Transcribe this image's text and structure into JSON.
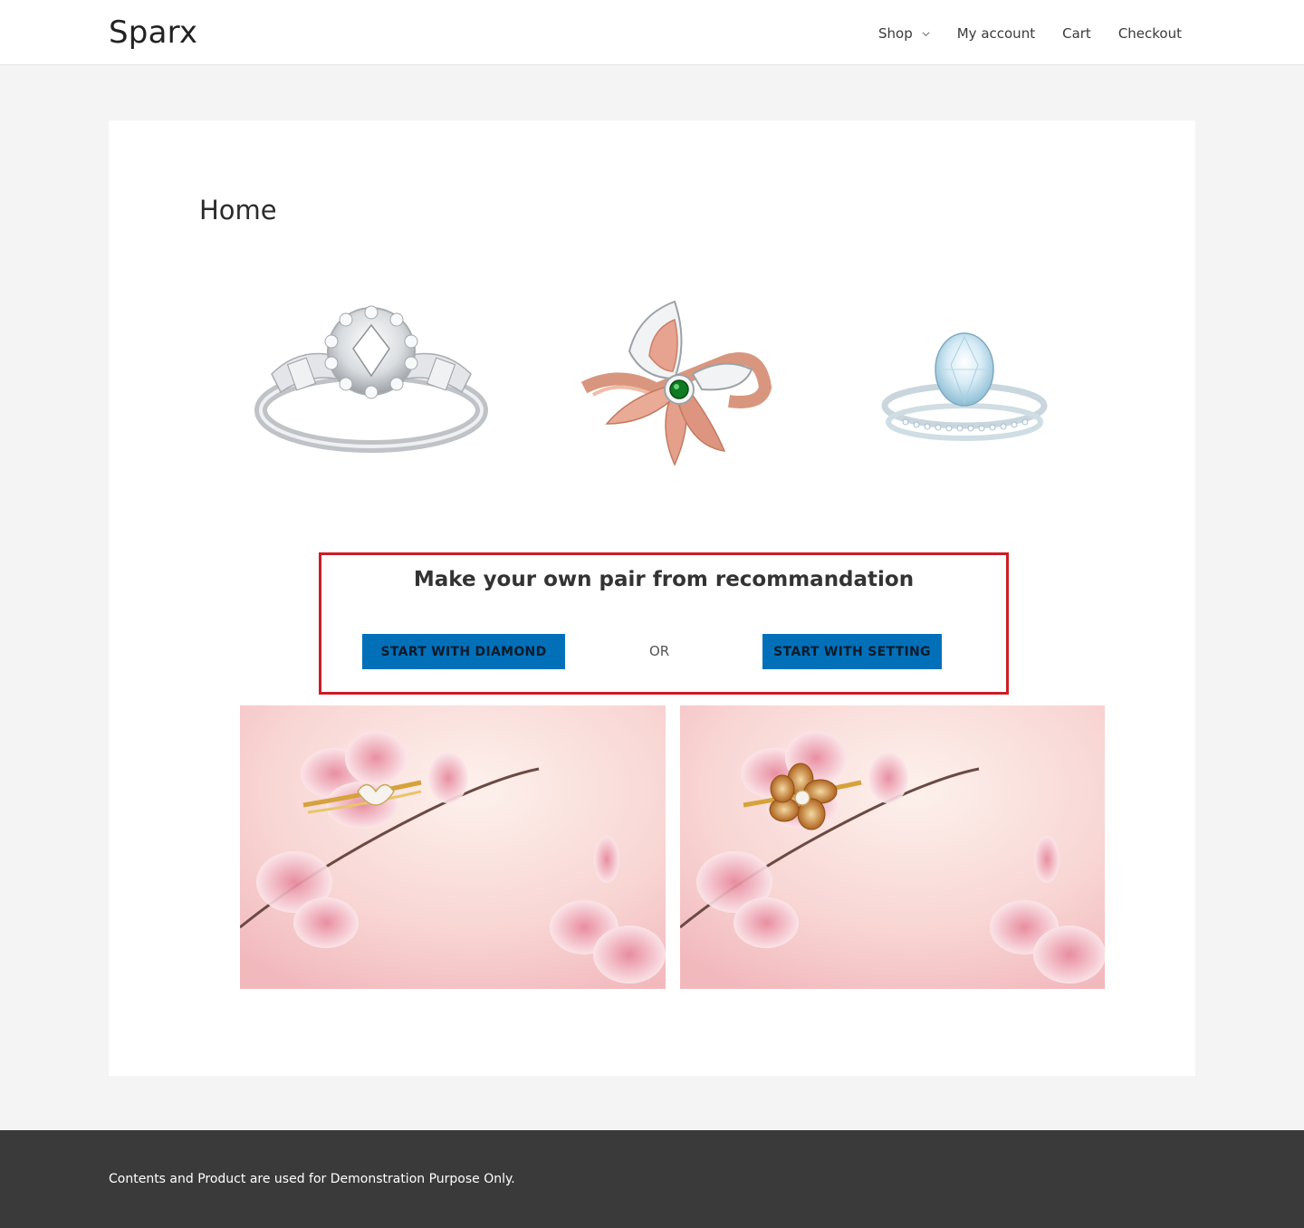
{
  "header": {
    "brand": "Sparx",
    "nav": [
      {
        "label": "Shop",
        "has_dropdown": true
      },
      {
        "label": "My account"
      },
      {
        "label": "Cart"
      },
      {
        "label": "Checkout"
      }
    ]
  },
  "main": {
    "title": "Home",
    "products": [
      {
        "name": "halo-diamond-ring-image"
      },
      {
        "name": "rose-gold-butterfly-emerald-ring-image"
      },
      {
        "name": "oval-solitaire-bridal-set-image"
      }
    ],
    "promo": {
      "heading": "Make your own pair from recommandation",
      "diamond_button": "START WITH DIAMOND",
      "separator": "OR",
      "setting_button": "START WITH SETTING",
      "border_color": "#cc1d25",
      "button_color": "#0170b9"
    },
    "banners": [
      {
        "name": "cherry-blossom-diamond-ring-banner"
      },
      {
        "name": "cherry-blossom-flower-ring-banner"
      }
    ]
  },
  "footer": {
    "text": "Contents and Product are used for Demonstration Purpose Only."
  }
}
